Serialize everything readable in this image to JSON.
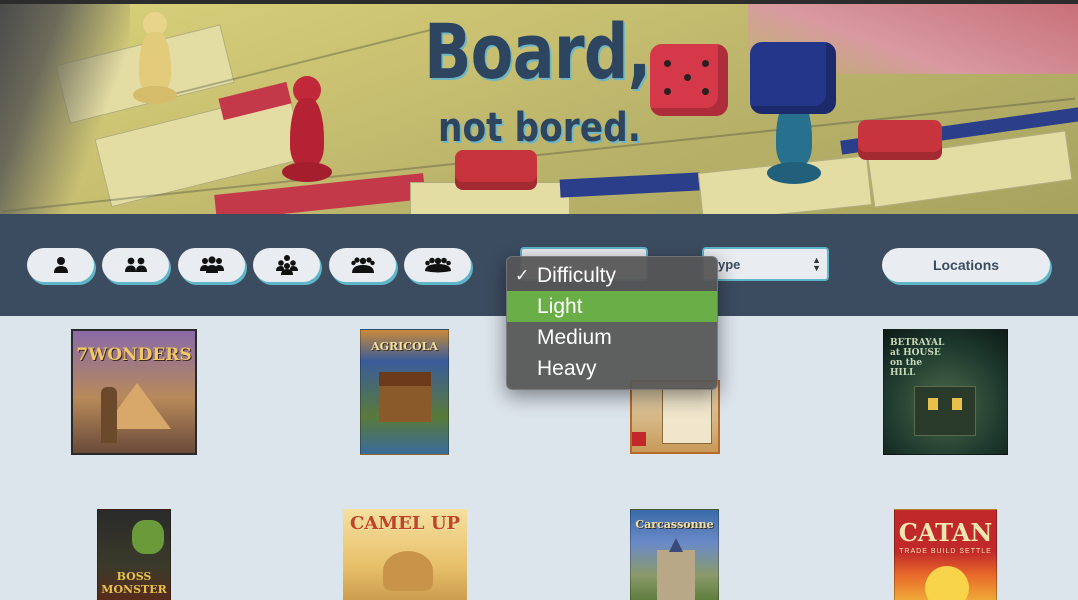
{
  "hero": {
    "title": "Board,",
    "subtitle": "not bored."
  },
  "filters": {
    "player_buttons": [
      {
        "icon": "one-player-icon",
        "players": 1
      },
      {
        "icon": "two-players-icon",
        "players": 2
      },
      {
        "icon": "three-players-icon",
        "players": 3
      },
      {
        "icon": "four-players-icon",
        "players": 4
      },
      {
        "icon": "five-players-icon",
        "players": 5
      },
      {
        "icon": "six-players-icon",
        "players": 6
      }
    ],
    "difficulty_select": {
      "value": "Difficulty",
      "options": [
        "Difficulty",
        "Light",
        "Medium",
        "Heavy"
      ],
      "checked": "Difficulty",
      "highlighted": "Light"
    },
    "type_select": {
      "value": "ype"
    },
    "locations_label": "Locations"
  },
  "games": [
    {
      "name": "7WONDERS",
      "cover_colors": [
        "#7a5a8a",
        "#c58a4a"
      ]
    },
    {
      "name": "AGRICOLA",
      "cover_colors": [
        "#3a5c9a",
        "#8a5a2a"
      ]
    },
    {
      "name": "",
      "cover_colors": [
        "#b86a2a",
        "#e6d8b8"
      ]
    },
    {
      "name": "BETRAYAL at HOUSE on the HILL",
      "cover_colors": [
        "#1e3a2e",
        "#4a6a4a"
      ]
    },
    {
      "name": "BOSS MONSTER",
      "cover_colors": [
        "#2a2a2a",
        "#6a8a3a"
      ]
    },
    {
      "name": "CAMEL UP",
      "cover_colors": [
        "#e8c06a",
        "#c0442a"
      ]
    },
    {
      "name": "Carcassonne",
      "cover_colors": [
        "#3a6aa8",
        "#7a9a4a"
      ]
    },
    {
      "name": "CATAN",
      "cover_colors": [
        "#c0282a",
        "#f0b03a"
      ]
    }
  ],
  "colors": {
    "filter_bar": "#3c4c60",
    "accent": "#5fb6c9",
    "page_bg": "#dce4ec",
    "highlight": "#6aae47"
  }
}
